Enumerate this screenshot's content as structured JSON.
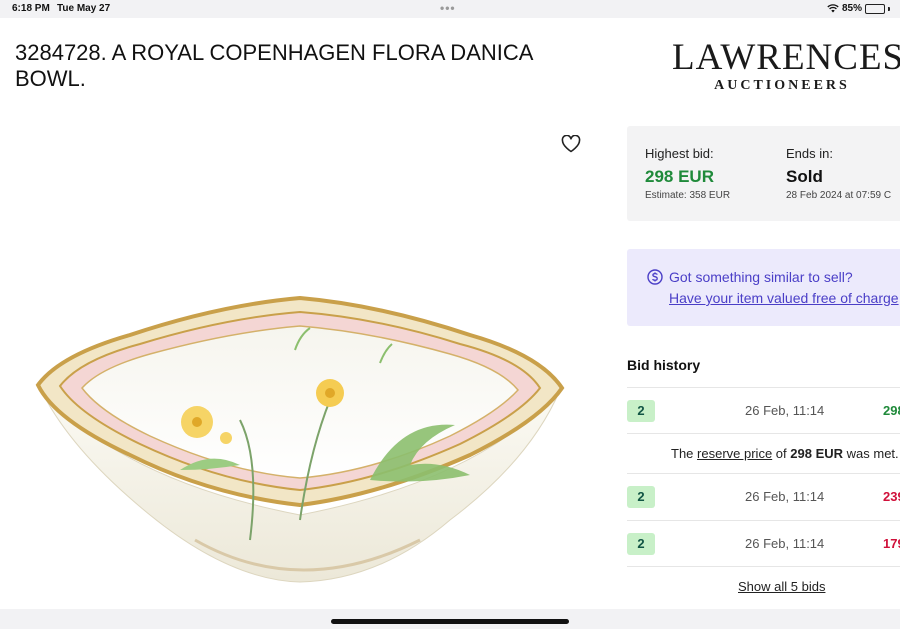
{
  "status_bar": {
    "time": "6:18 PM",
    "date": "Tue May 27",
    "dots": "•••",
    "battery": "85%",
    "battery_level": 0.85
  },
  "lot": {
    "title": "3284728. A ROYAL COPENHAGEN FLORA DANICA BOWL."
  },
  "logo": {
    "main": "LAWRENCES",
    "sub": "AUCTIONEERS"
  },
  "icons": {
    "favorite": "heart-outline-icon",
    "sell": "dollar-circle-icon",
    "wifi": "wifi-icon",
    "battery": "battery-charging-icon"
  },
  "bid_summary": {
    "highest_bid_label": "Highest bid:",
    "highest_bid_value": "298 EUR",
    "estimate": "Estimate: 358 EUR",
    "ends_label": "Ends in:",
    "status": "Sold",
    "end_date": "28 Feb 2024 at 07:59 C"
  },
  "sell_promo": {
    "question": "Got something similar to sell?",
    "link": "Have your item valued free of charge"
  },
  "bid_history": {
    "title": "Bid history",
    "rows": [
      {
        "bidder": "2",
        "time": "26 Feb, 11:14",
        "amount": "298",
        "color": "#1f8a3a"
      },
      {
        "bidder": "2",
        "time": "26 Feb, 11:14",
        "amount": "239",
        "color": "#d0103a"
      },
      {
        "bidder": "2",
        "time": "26 Feb, 11:14",
        "amount": "179",
        "color": "#d0103a"
      }
    ],
    "reserve": {
      "prefix": "The",
      "link": "reserve price",
      "middle": "of",
      "amount": "298 EUR",
      "suffix": "was met."
    },
    "show_all": "Show all 5 bids"
  },
  "colors": {
    "accent_green": "#1f8a3a",
    "accent_purple": "#4a3ec7",
    "sell_bg": "#eceafc",
    "badge_bg": "#c8f0c8"
  }
}
